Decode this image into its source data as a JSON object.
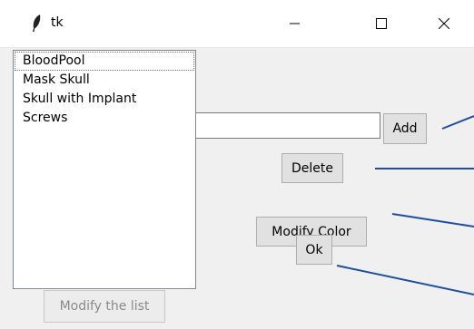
{
  "window": {
    "title": "tk",
    "icon": "feather-icon",
    "controls": [
      "minimize-icon",
      "maximize-icon",
      "close-icon"
    ]
  },
  "listbox": {
    "items": [
      {
        "label": "BloodPool",
        "selected": true
      },
      {
        "label": "Mask Skull",
        "selected": false
      },
      {
        "label": "Skull with Implant",
        "selected": false
      },
      {
        "label": "Screws",
        "selected": false
      }
    ]
  },
  "entry": {
    "value": ""
  },
  "buttons": {
    "add": "Add",
    "delete": "Delete",
    "modify_color": "Modify Color",
    "ok": "Ok",
    "modify_list": "Modify the list"
  },
  "colors": {
    "window_bg": "#f0f0f0",
    "annotation_line": "#1f4e9a"
  }
}
